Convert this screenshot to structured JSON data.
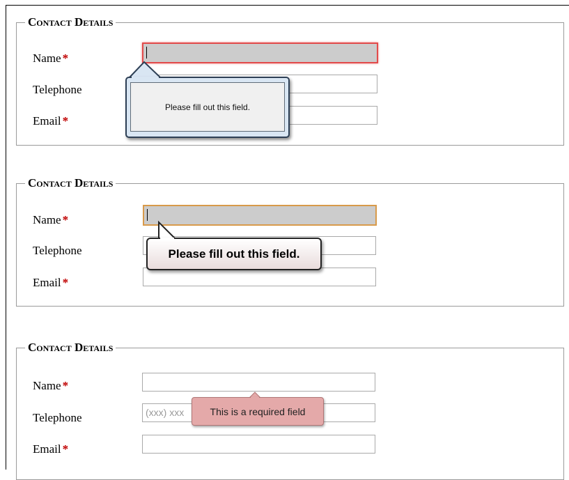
{
  "sets": [
    {
      "legend": "Contact Details",
      "fields": [
        {
          "label": "Name",
          "required": true,
          "value": "",
          "placeholder": ""
        },
        {
          "label": "Telephone",
          "required": false,
          "value": "",
          "placeholder": ""
        },
        {
          "label": "Email",
          "required": true,
          "value": "",
          "placeholder": ""
        }
      ],
      "tooltip": "Please fill out this field."
    },
    {
      "legend": "Contact Details",
      "fields": [
        {
          "label": "Name",
          "required": true,
          "value": "",
          "placeholder": ""
        },
        {
          "label": "Telephone",
          "required": false,
          "value": "",
          "placeholder": ""
        },
        {
          "label": "Email",
          "required": true,
          "value": "",
          "placeholder": ""
        }
      ],
      "tooltip": "Please fill out this field."
    },
    {
      "legend": "Contact Details",
      "fields": [
        {
          "label": "Name",
          "required": true,
          "value": "",
          "placeholder": ""
        },
        {
          "label": "Telephone",
          "required": false,
          "value": "",
          "placeholder": "(xxx) xxx"
        },
        {
          "label": "Email",
          "required": true,
          "value": "",
          "placeholder": ""
        }
      ],
      "tooltip": "This is a required field"
    }
  ],
  "required_marker": "*",
  "colors": {
    "required_marker": "#c00000",
    "invalid_field_border": "#e24b4b",
    "focused_field_border": "#d89a4a",
    "focused_field_fill": "#cccccc",
    "tooltip3_fill": "#e4a9a9"
  }
}
